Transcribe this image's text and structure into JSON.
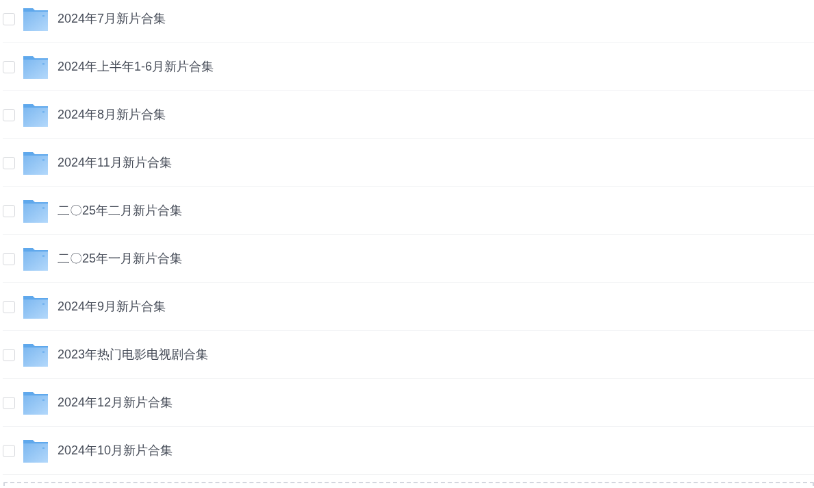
{
  "folders": [
    {
      "name": "2024年7月新片合集",
      "checked": false
    },
    {
      "name": "2024年上半年1-6月新片合集",
      "checked": false
    },
    {
      "name": "2024年8月新片合集",
      "checked": false
    },
    {
      "name": "2024年11月新片合集",
      "checked": false
    },
    {
      "name": "二〇25年二月新片合集",
      "checked": false
    },
    {
      "name": "二〇25年一月新片合集",
      "checked": false
    },
    {
      "name": "2024年9月新片合集",
      "checked": false
    },
    {
      "name": "2023年热门电影电视剧合集",
      "checked": false
    },
    {
      "name": "2024年12月新片合集",
      "checked": false
    },
    {
      "name": "2024年10月新片合集",
      "checked": false
    }
  ]
}
